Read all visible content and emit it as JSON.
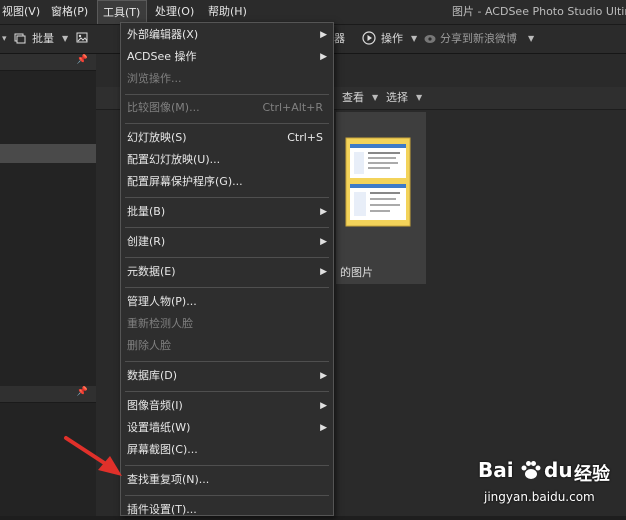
{
  "menubar": {
    "items": [
      "视图(V)",
      "窗格(P)",
      "工具(T)",
      "处理(O)",
      "帮助(H)"
    ],
    "app_title": "图片 - ACDSee Photo Studio Ultin"
  },
  "toolbar": {
    "batch_label": "批量",
    "editor_fragment": "器",
    "actions_label": "操作",
    "share_label": "分享到新浪微博"
  },
  "filter_bar": {
    "view_label": "查看",
    "select_label": "选择"
  },
  "thumbnail": {
    "caption": "的图片"
  },
  "tools_menu": {
    "items": [
      {
        "label": "外部编辑器(X)",
        "submenu": true
      },
      {
        "label": "ACDSee 操作",
        "submenu": true
      },
      {
        "label": "浏览操作...",
        "disabled": true
      },
      {
        "label": "比较图像(M)...",
        "shortcut": "Ctrl+Alt+R",
        "disabled": true
      },
      {
        "label": "幻灯放映(S)",
        "shortcut": "Ctrl+S"
      },
      {
        "label": "配置幻灯放映(U)..."
      },
      {
        "label": "配置屏幕保护程序(G)..."
      },
      {
        "label": "批量(B)",
        "submenu": true
      },
      {
        "label": "创建(R)",
        "submenu": true
      },
      {
        "label": "元数据(E)",
        "submenu": true
      },
      {
        "label": "管理人物(P)..."
      },
      {
        "label": "重新检测人脸",
        "disabled": true
      },
      {
        "label": "删除人脸",
        "disabled": true
      },
      {
        "label": "数据库(D)",
        "submenu": true
      },
      {
        "label": "图像音频(I)",
        "submenu": true
      },
      {
        "label": "设置墙纸(W)",
        "submenu": true
      },
      {
        "label": "屏幕截图(C)..."
      },
      {
        "label": "查找重复项(N)..."
      },
      {
        "label": "插件设置(T)..."
      }
    ]
  },
  "watermark": {
    "brand": "Bai",
    "brand2": "du",
    "suffix": "经验",
    "url": "jingyan.baidu.com"
  },
  "colors": {
    "menu_bg": "#2e2e2e",
    "annotation_arrow": "#e0302a",
    "folder_yellow": "#f3d35a"
  }
}
